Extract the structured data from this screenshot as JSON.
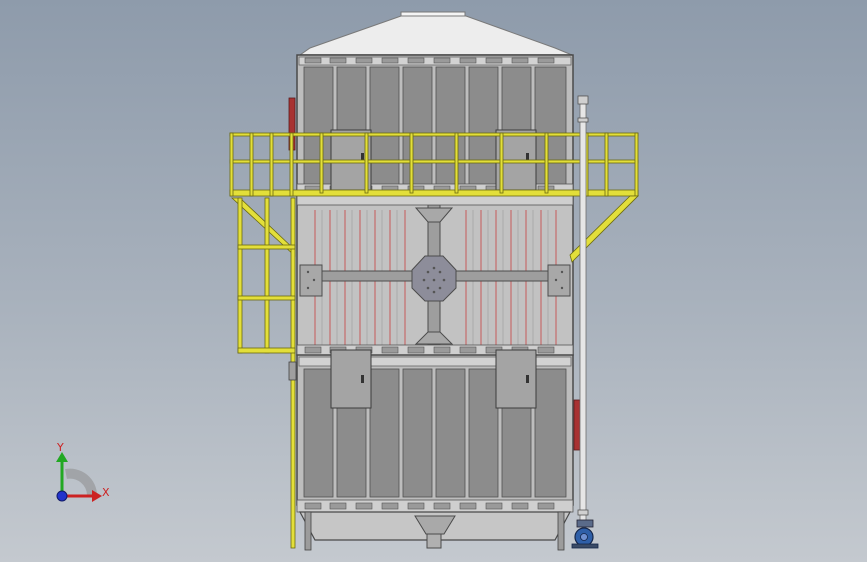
{
  "viewport": {
    "background_top": "#8e9bab",
    "background_bottom": "#c4c9cf"
  },
  "model": {
    "panel_color": "#8c8c8c",
    "panel_dark": "#6d6d6d",
    "frame_color": "#b9b9b9",
    "roof_color": "#eeeeee",
    "platform_color": "#e3df3a",
    "accent_red": "#a83232",
    "filter_line_color": "#c65a5a",
    "pump_color": "#2f5fa8"
  },
  "triad": {
    "y_label": "Y",
    "x_label": "X",
    "y_color": "#22a822",
    "x_color": "#cc2222",
    "origin_color": "#2233cc"
  }
}
